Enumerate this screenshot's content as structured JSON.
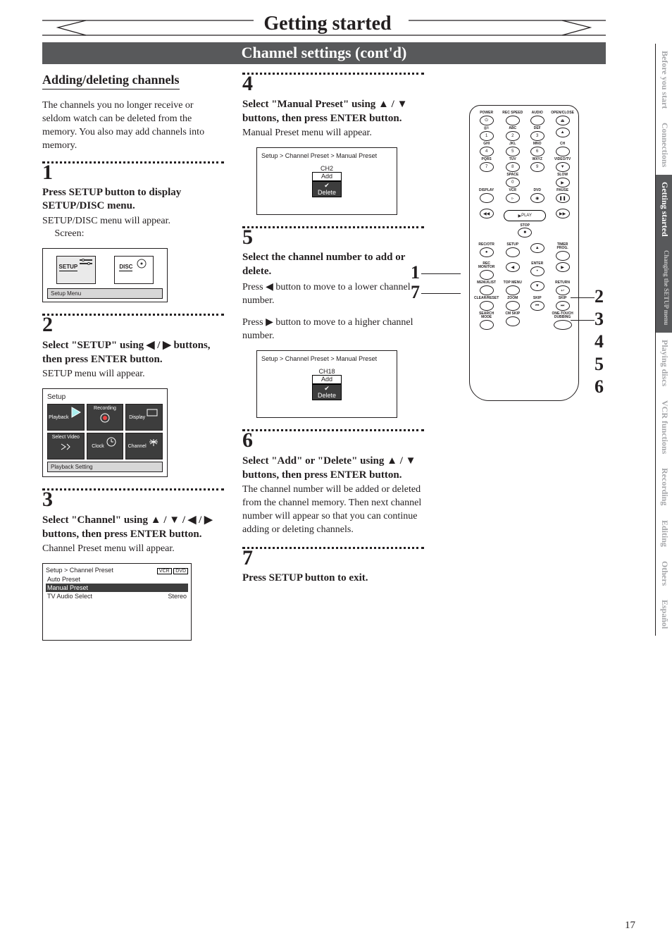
{
  "banner_title": "Getting started",
  "section_bar": "Channel settings (cont'd)",
  "page_number": "17",
  "subhead": "Adding/deleting channels",
  "intro": "The channels you no longer receive or seldom watch can be deleted from the memory. You also may add channels into memory.",
  "steps": {
    "s1": {
      "num": "1",
      "title": "Press SETUP button to display SETUP/DISC menu.",
      "body": "SETUP/DISC menu will appear.",
      "screen_label": "Screen:",
      "setup_label": "SETUP",
      "disc_label": "DISC",
      "caption": "Setup Menu"
    },
    "s2": {
      "num": "2",
      "title_pre": "Select \"SETUP\" using ",
      "title_mid": " / ",
      "title_post": " buttons, then press ENTER button.",
      "body": "SETUP menu will appear.",
      "menu_title": "Setup",
      "cells": [
        "Playback",
        "Recording",
        "Display",
        "Select Video",
        "Clock",
        "Channel"
      ],
      "footer": "Playback Setting"
    },
    "s3": {
      "num": "3",
      "title_pre": "Select \"Channel\" using ",
      "title_post": " buttons, then press ENTER button.",
      "body": "Channel Preset menu will appear.",
      "bc": "Setup > Channel Preset",
      "tag1": "VCR",
      "tag2": "DVD",
      "rows": [
        "Auto Preset",
        "Manual Preset",
        "TV Audio Select"
      ],
      "row3_val": "Stereo"
    },
    "s4": {
      "num": "4",
      "title_pre": "Select \"Manual Preset\" using ",
      "title_post": " buttons, then press ENTER button.",
      "body": "Manual Preset menu will appear.",
      "bc": "Setup > Channel Preset > Manual Preset",
      "ch": "CH2",
      "add": "Add",
      "del": "Delete"
    },
    "s5": {
      "num": "5",
      "title": "Select the channel number to add or delete.",
      "body1_pre": "Press ",
      "body1_post": " button to move to a lower channel number.",
      "body2_pre": "Press ",
      "body2_post": " button to move to a higher channel number.",
      "bc": "Setup > Channel Preset > Manual Preset",
      "ch": "CH18",
      "add": "Add",
      "del": "Delete"
    },
    "s6": {
      "num": "6",
      "title_pre": "Select \"Add\" or \"Delete\" using ",
      "title_post": " buttons, then press ENTER button.",
      "body": "The channel number will be added or deleted from the channel memory. Then next channel number will appear so that you can continue adding or deleting channels."
    },
    "s7": {
      "num": "7",
      "title": "Press SETUP button to exit."
    }
  },
  "remote": {
    "row1": [
      "POWER",
      "REC SPEED",
      "AUDIO",
      "OPEN/CLOSE"
    ],
    "num_labels": [
      "@/:",
      "ABC",
      "DEF",
      "",
      "GHI",
      "JKL",
      "MNO",
      "CH",
      "PQRS",
      "TUV",
      "WXYZ",
      "VIDEO/TV"
    ],
    "nums": [
      "1",
      "2",
      "3",
      "▲",
      "4",
      "5",
      "6",
      "",
      "7",
      "8",
      "9",
      "▼"
    ],
    "space": "SPACE",
    "slow": "SLOW",
    "zero": "0",
    "row_disp": [
      "DISPLAY",
      "VCR",
      "DVD",
      "PAUSE"
    ],
    "play": "PLAY",
    "stop": "STOP",
    "row_rec": [
      "REC/OTR",
      "SETUP",
      "",
      "TIMER PROG."
    ],
    "row_mon": [
      "REC MONITOR",
      "",
      "ENTER",
      ""
    ],
    "row_menu": [
      "MENU/LIST",
      "TOP MENU",
      "",
      "RETURN"
    ],
    "row_clr": [
      "CLEAR/RESET",
      "ZOOM",
      "SKIP",
      "SKIP"
    ],
    "row_srch": [
      "SEARCH MODE",
      "CM SKIP",
      "",
      "ONE-TOUCH DUBBING"
    ]
  },
  "callouts_left": {
    "c1": "1",
    "c7": "7"
  },
  "callouts_right": {
    "c2": "2",
    "c3": "3",
    "c4": "4",
    "c5": "5",
    "c6": "6"
  },
  "tabs": [
    "Before you start",
    "Connections",
    "Getting started",
    "Changing the SETUP menu",
    "Playing discs",
    "VCR functions",
    "Recording",
    "Editing",
    "Others",
    "Español"
  ]
}
